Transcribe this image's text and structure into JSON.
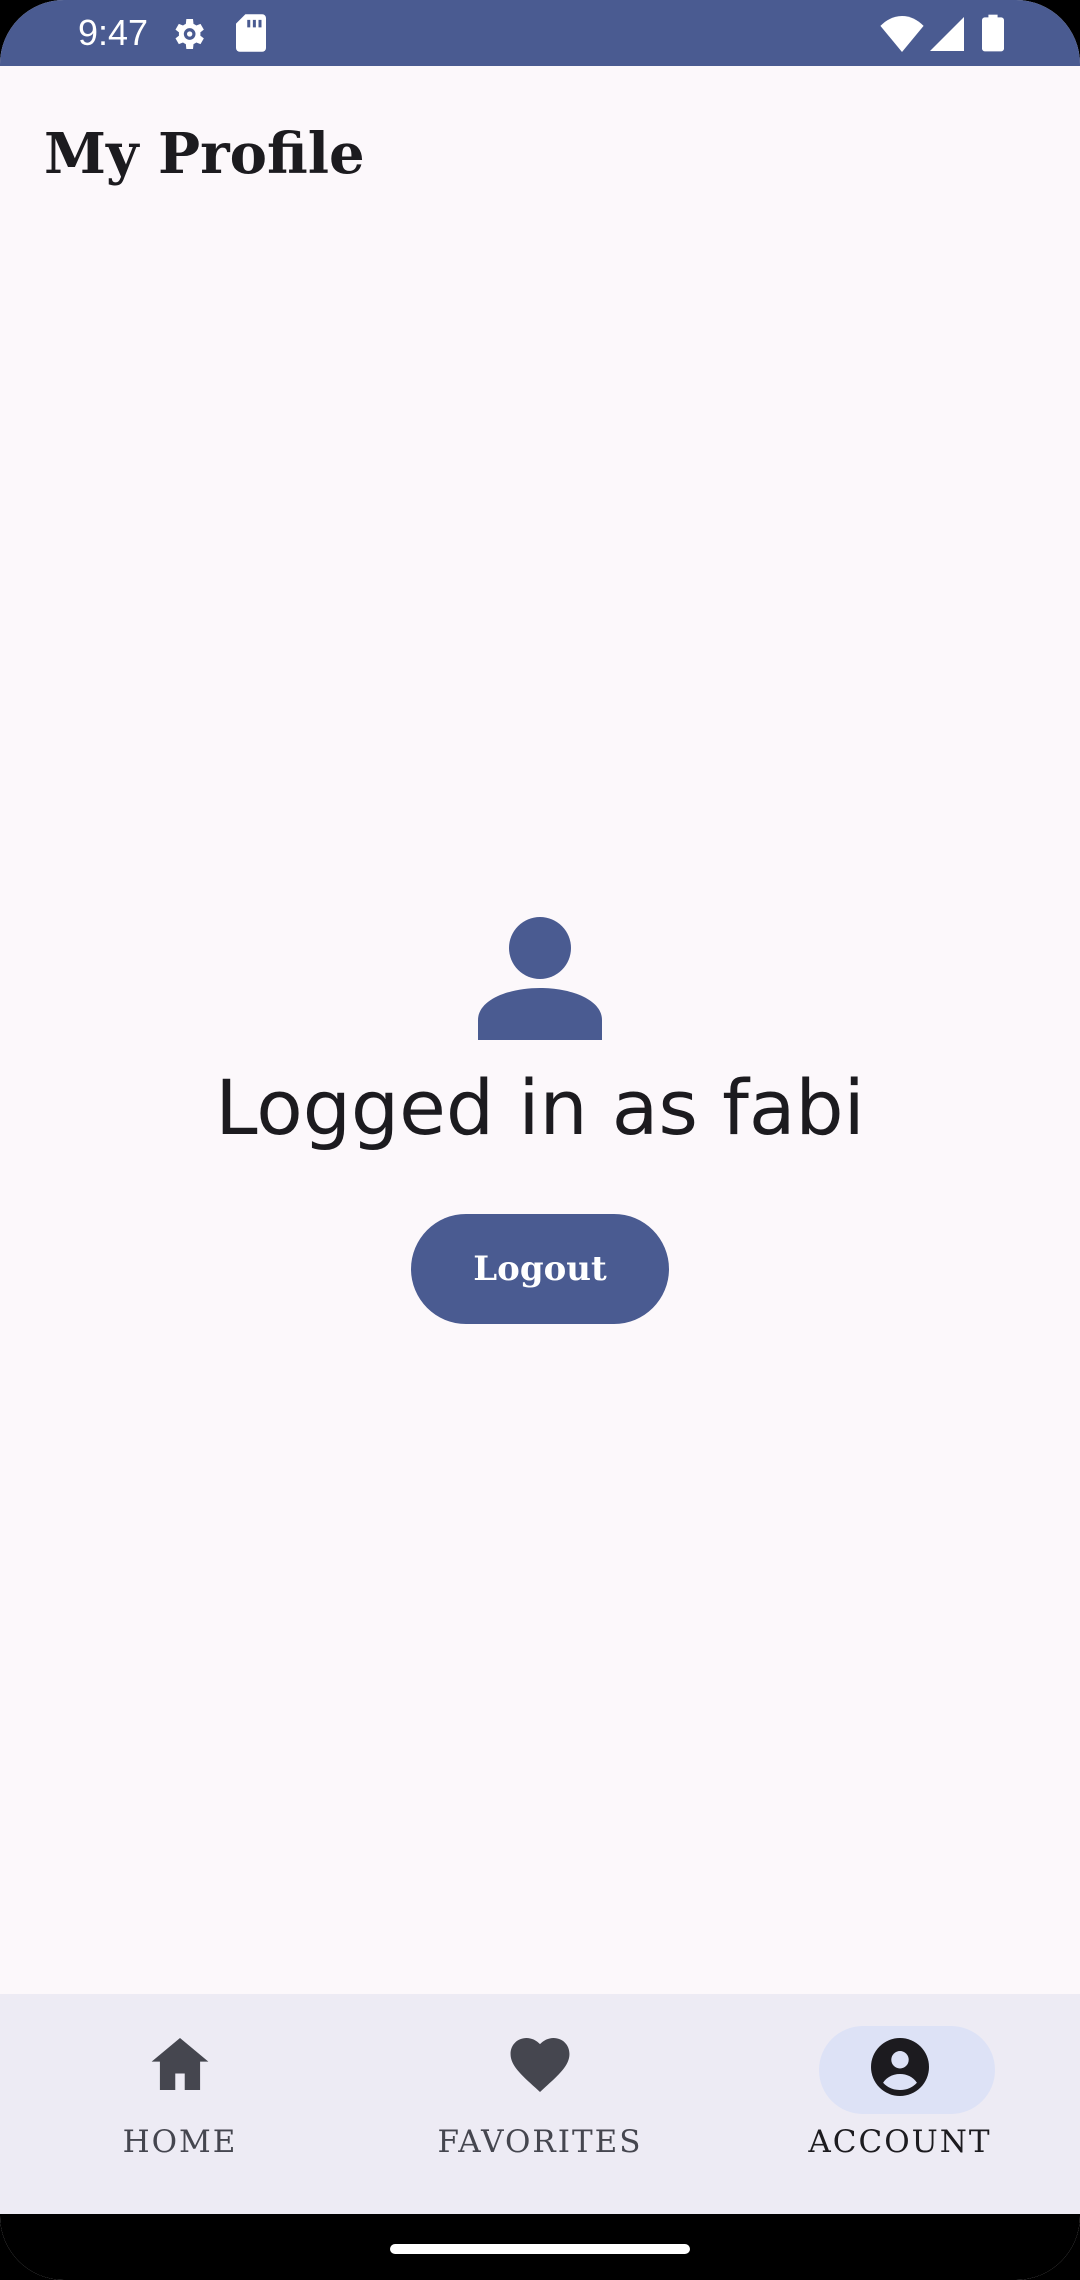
{
  "status_bar": {
    "time": "9:47",
    "background_color": "#4A5B91",
    "icons": [
      "settings-gear-icon",
      "sd-card-icon",
      "wifi-icon",
      "cellular-signal-icon",
      "battery-icon"
    ]
  },
  "header": {
    "title": "My Profile"
  },
  "profile": {
    "icon": "person-icon",
    "logged_in_text": "Logged in as fabi",
    "logout_label": "Logout",
    "accent_color": "#4A5B91"
  },
  "bottom_nav": {
    "items": [
      {
        "label": "HOME",
        "icon": "home-icon",
        "selected": false
      },
      {
        "label": "FAVORITES",
        "icon": "heart-icon",
        "selected": false
      },
      {
        "label": "ACCOUNT",
        "icon": "account-circle-icon",
        "selected": true
      }
    ],
    "selected_pill_color": "#DDE2F6"
  }
}
